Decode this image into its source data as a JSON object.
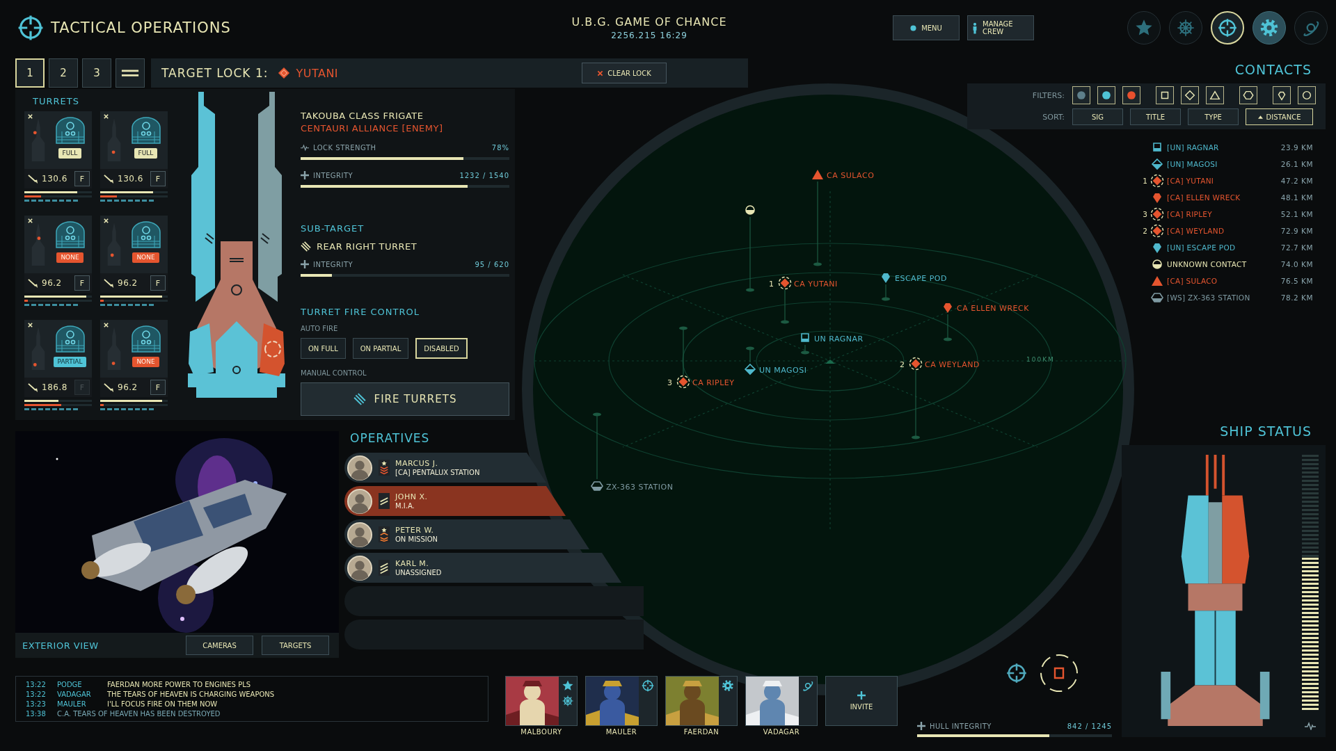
{
  "header": {
    "title": "TACTICAL OPERATIONS",
    "ship_name": "U.B.G. GAME OF CHANCE",
    "date": "2256.215 16:29",
    "buttons": [
      {
        "label": "MENU",
        "kind": "dot"
      },
      {
        "label": "MANAGE CREW",
        "kind": "person"
      }
    ],
    "nav": [
      {
        "kind": "star",
        "selected": false,
        "highlighted": false
      },
      {
        "kind": "wheel",
        "selected": false,
        "highlighted": false
      },
      {
        "kind": "crosshair",
        "selected": true,
        "highlighted": false
      },
      {
        "kind": "gear",
        "selected": false,
        "highlighted": true
      },
      {
        "kind": "orbit",
        "selected": false,
        "highlighted": false
      }
    ]
  },
  "target_tabs": [
    {
      "kind": "number",
      "label": "1",
      "selected": true
    },
    {
      "kind": "number",
      "label": "2",
      "selected": false
    },
    {
      "kind": "number",
      "label": "3",
      "selected": false
    },
    {
      "kind": "all",
      "selected": false
    }
  ],
  "target_lock": {
    "label": "TARGET LOCK 1:",
    "name": "YUTANI",
    "clear_button": "CLEAR LOCK"
  },
  "turrets": {
    "title": "TURRETS",
    "items": [
      {
        "mode": "FULL",
        "kind": "full",
        "damage": "130.6",
        "fire": "F",
        "fire_enabled": true,
        "health": {
          "level": 0.78
        },
        "heat": {
          "level": 0.25
        }
      },
      {
        "mode": "FULL",
        "kind": "full",
        "damage": "130.6",
        "fire": "F",
        "fire_enabled": true,
        "health": {
          "level": 0.78
        },
        "heat": {
          "level": 0.25
        }
      },
      {
        "mode": "NONE",
        "kind": "none",
        "damage": "96.2",
        "fire": "F",
        "fire_enabled": true,
        "health": {
          "level": 0.92
        },
        "heat": {
          "level": 0.05
        }
      },
      {
        "mode": "NONE",
        "kind": "none",
        "damage": "96.2",
        "fire": "F",
        "fire_enabled": true,
        "health": {
          "level": 0.92
        },
        "heat": {
          "level": 0.05
        }
      },
      {
        "mode": "PARTIAL",
        "kind": "partial",
        "damage": "186.8",
        "fire": "F",
        "fire_enabled": false,
        "health": {
          "level": 0.5
        },
        "heat": {
          "level": 0.55
        }
      },
      {
        "mode": "NONE",
        "kind": "none",
        "damage": "96.2",
        "fire": "F",
        "fire_enabled": true,
        "health": {
          "level": 0.92
        },
        "heat": {
          "level": 0.05
        }
      }
    ]
  },
  "target": {
    "class": "TAKOUBA CLASS FRIGATE",
    "faction": "CENTAURI ALLIANCE [ENEMY]",
    "lock_label": "LOCK STRENGTH",
    "lock_value": "78%",
    "lock": {
      "level": 0.78
    },
    "integrity_label": "INTEGRITY",
    "integrity_value": "1232 / 1540",
    "integrity": {
      "level": 0.8
    }
  },
  "sub_target": {
    "title": "SUB-TARGET",
    "name": "REAR RIGHT TURRET",
    "integrity_label": "INTEGRITY",
    "integrity_value": "95 / 620",
    "integrity": {
      "level": 0.15
    }
  },
  "fire_control": {
    "title": "TURRET FIRE CONTROL",
    "auto_label": "AUTO FIRE",
    "modes": [
      {
        "label": "ON FULL",
        "selected": false
      },
      {
        "label": "ON PARTIAL",
        "selected": false
      },
      {
        "label": "DISABLED",
        "selected": true
      }
    ],
    "manual_label": "MANUAL CONTROL",
    "fire_button": "FIRE TURRETS"
  },
  "exterior_view": {
    "label": "EXTERIOR VIEW",
    "buttons": [
      "CAMERAS",
      "TARGETS"
    ]
  },
  "operatives": {
    "title": "OPERATIVES",
    "items": [
      {
        "name": "MARCUS J.",
        "status": "[CA] PENTALUX STATION",
        "kind": "sergeant",
        "selected": false
      },
      {
        "name": "JOHN X.",
        "status": "M.I.A.",
        "kind": "corporal",
        "selected": true
      },
      {
        "name": "PETER W.",
        "status": "ON MISSION",
        "kind": "staff-sergeant",
        "selected": false
      },
      {
        "name": "KARL M.",
        "status": "UNASSIGNED",
        "kind": "private",
        "selected": false
      }
    ]
  },
  "radar": {
    "scale": "100KM",
    "contacts": [
      {
        "label": "CA SULACO",
        "kind": "triangle",
        "color": "#e5552f"
      },
      {
        "kind": "circle",
        "color": "#e8e6b4"
      },
      {
        "lock": "1",
        "label": "CA YUTANI",
        "kind": "locked",
        "color": "#e5552f"
      },
      {
        "label": "ESCAPE POD",
        "kind": "pin",
        "color": "#4fb8cc"
      },
      {
        "label": "CA ELLEN WRECK",
        "kind": "pin",
        "color": "#e5552f"
      },
      {
        "label": "UN RAGNAR",
        "kind": "square",
        "color": "#4fb8cc"
      },
      {
        "label": "UN MAGOSI",
        "kind": "diamond",
        "color": "#4fb8cc"
      },
      {
        "lock": "3",
        "label": "CA RIPLEY",
        "kind": "locked",
        "color": "#e5552f"
      },
      {
        "lock": "2",
        "label": "CA WEYLAND",
        "kind": "locked",
        "color": "#e5552f"
      },
      {
        "label": "ZX-363 STATION",
        "kind": "hexagon",
        "color": "#7f9aa2"
      }
    ]
  },
  "contacts": {
    "title": "CONTACTS",
    "filters_label": "FILTERS:",
    "filters": [
      {
        "kind": "dot",
        "color": "#5e7f8a"
      },
      {
        "kind": "dot",
        "color": "#4fc3d6"
      },
      {
        "kind": "dot",
        "color": "#e8502e"
      },
      {
        "kind": "square"
      },
      {
        "kind": "diamond"
      },
      {
        "kind": "triangle"
      },
      {
        "kind": "hexagon"
      },
      {
        "kind": "pin"
      },
      {
        "kind": "circle"
      }
    ],
    "sort_label": "SORT:",
    "sort": [
      {
        "label": "SIG",
        "selected": false
      },
      {
        "label": "TITLE",
        "selected": false
      },
      {
        "label": "TYPE",
        "selected": false
      },
      {
        "label": "DISTANCE",
        "selected": true
      }
    ],
    "items": [
      {
        "name": "[UN] RAGNAR",
        "distance": "23.9 KM",
        "kind": "square",
        "color": "#4fb8cc"
      },
      {
        "name": "[UN] MAGOSI",
        "distance": "26.1 KM",
        "kind": "diamond",
        "color": "#4fb8cc"
      },
      {
        "lock": "1",
        "name": "[CA] YUTANI",
        "distance": "47.2 KM",
        "kind": "locked",
        "color": "#e5552f"
      },
      {
        "name": "[CA] ELLEN WRECK",
        "distance": "48.1 KM",
        "kind": "pin",
        "color": "#e5552f"
      },
      {
        "lock": "3",
        "name": "[CA] RIPLEY",
        "distance": "52.1 KM",
        "kind": "locked",
        "color": "#e5552f"
      },
      {
        "lock": "2",
        "name": "[CA] WEYLAND",
        "distance": "72.9 KM",
        "kind": "locked",
        "color": "#e5552f"
      },
      {
        "name": "[UN] ESCAPE POD",
        "distance": "72.7 KM",
        "kind": "pin",
        "color": "#4fb8cc"
      },
      {
        "name": "UNKNOWN CONTACT",
        "distance": "74.0 KM",
        "kind": "circle",
        "color": "#e8e6b4"
      },
      {
        "name": "[CA] SULACO",
        "distance": "76.5 KM",
        "kind": "triangle",
        "color": "#e5552f"
      },
      {
        "name": "[WS] ZX-363 STATION",
        "distance": "78.2 KM",
        "kind": "hexagon",
        "color": "#7f9aa2"
      }
    ]
  },
  "ship_status": {
    "title": "SHIP STATUS",
    "hull_label": "HULL INTEGRITY",
    "hull_value": "842 / 1245",
    "hull": {
      "level": 0.68
    },
    "power": {
      "level": 0.6
    }
  },
  "chat": [
    {
      "kind": "chat",
      "time": "13:22",
      "sender": "PODGE",
      "message": "FAERDAN MORE POWER TO ENGINES PLS"
    },
    {
      "kind": "chat",
      "time": "13:22",
      "sender": "VADAGAR",
      "message": "THE TEARS OF HEAVEN IS CHARGING WEAPONS"
    },
    {
      "kind": "chat",
      "time": "13:23",
      "sender": "MAULER",
      "message": "I'LL FOCUS FIRE ON THEM NOW"
    },
    {
      "kind": "system",
      "time": "13:38",
      "message": "C.A. TEARS OF HEAVEN HAS BEEN DESTROYED"
    }
  ],
  "party": {
    "members": [
      {
        "name": "MALBOURY",
        "roles": [
          {
            "kind": "star"
          },
          {
            "kind": "wheel"
          }
        ]
      },
      {
        "name": "MAULER",
        "roles": [
          {
            "kind": "crosshair"
          }
        ]
      },
      {
        "name": "FAERDAN",
        "roles": [
          {
            "kind": "gear"
          }
        ]
      },
      {
        "name": "VADAGAR",
        "roles": [
          {
            "kind": "orbit"
          }
        ]
      }
    ],
    "invite": "INVITE"
  }
}
